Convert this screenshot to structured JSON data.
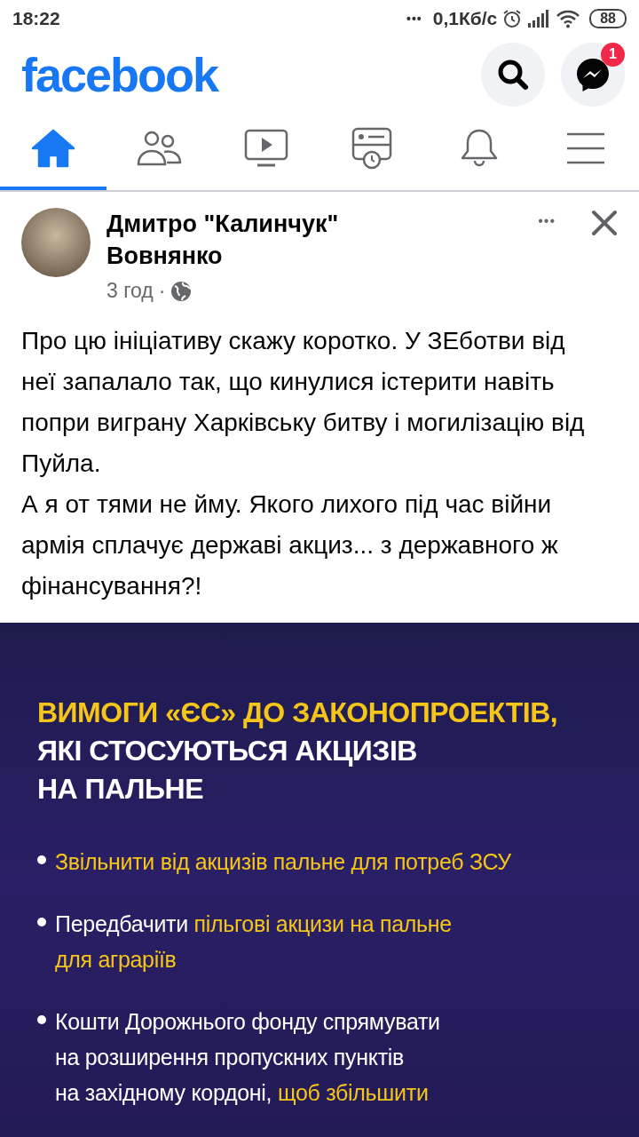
{
  "status_bar": {
    "time": "18:22",
    "dots": "•••",
    "speed": "0,1Кб/с",
    "battery": "88"
  },
  "header": {
    "logo": "facebook",
    "messenger_badge": "1"
  },
  "tabs": [
    {
      "selected": true
    },
    {
      "selected": false
    },
    {
      "selected": false
    },
    {
      "selected": false
    },
    {
      "selected": false
    },
    {
      "selected": false
    }
  ],
  "post": {
    "author": "Дмитро \"Калинчук\" Вовнянко",
    "time": "3 год",
    "separator": "·",
    "more": "•••",
    "text": [
      "Про цю ініціативу скажу коротко. У ЗЕботви від неї запалало так, що кинулися істерити навіть попри виграну Харківську битву і могилізацію від Пуйла.",
      "А я от тями не йму. Якого лихого під час війни армія сплачує державі акциз... з державного ж фінансування?!"
    ],
    "graphic": {
      "heading": [
        {
          "text": "ВИМОГИ «ЄС» ДО ЗАКОНОПРОЕКТІВ,",
          "highlight": true
        },
        {
          "text": "ЯКІ СТОСУЮТЬСЯ АКЦИЗІВ",
          "highlight": false
        },
        {
          "text": "НА ПАЛЬНЕ",
          "highlight": false
        }
      ],
      "bullets": [
        {
          "lines": [
            [
              {
                "text": "Звільнити від акцизів пальне для потреб ЗСУ",
                "highlight": true
              }
            ]
          ]
        },
        {
          "lines": [
            [
              {
                "text": "Передбачити ",
                "highlight": false
              },
              {
                "text": "пільгові акцизи на пальне",
                "highlight": true
              }
            ],
            [
              {
                "text": "для аграріїв",
                "highlight": true
              }
            ]
          ]
        },
        {
          "lines": [
            [
              {
                "text": "Кошти Дорожнього фонду спрямувати",
                "highlight": false
              }
            ],
            [
              {
                "text": "на розширення пропускних пунктів",
                "highlight": false
              }
            ],
            [
              {
                "text": "на західному кордоні, ",
                "highlight": false
              },
              {
                "text": "щоб збільшити",
                "highlight": true
              }
            ]
          ]
        }
      ]
    }
  }
}
